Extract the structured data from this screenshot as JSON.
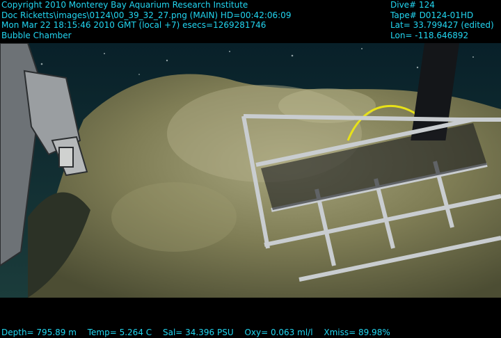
{
  "overlay": {
    "top_left": [
      "Copyright 2010 Monterey Bay Aquarium Research Institute",
      "Doc Ricketts\\images\\0124\\00_39_32_27.png (MAIN)  HD=00:42:06:09",
      "Mon Mar 22 18:15:46 2010 GMT (local +7)  esecs=1269281746",
      "Bubble Chamber"
    ],
    "top_right": [
      "Dive# 124",
      "Tape# D0124-01HD",
      "Lat= 33.799427 (edited)",
      "Lon= -118.646892"
    ],
    "bottom": [
      "Depth= 795.89 m",
      "Temp= 5.264 C",
      "Sal= 34.396 PSU",
      "Oxy= 0.063 ml/l",
      "Xmiss= 89.98%"
    ],
    "color": "#22d7e6"
  },
  "scene": {
    "water_color": "#0e2a33",
    "seafloor_color": "#8f8a5c",
    "cage_color": "#c9cdd0",
    "cable_color": "#e8e218"
  }
}
